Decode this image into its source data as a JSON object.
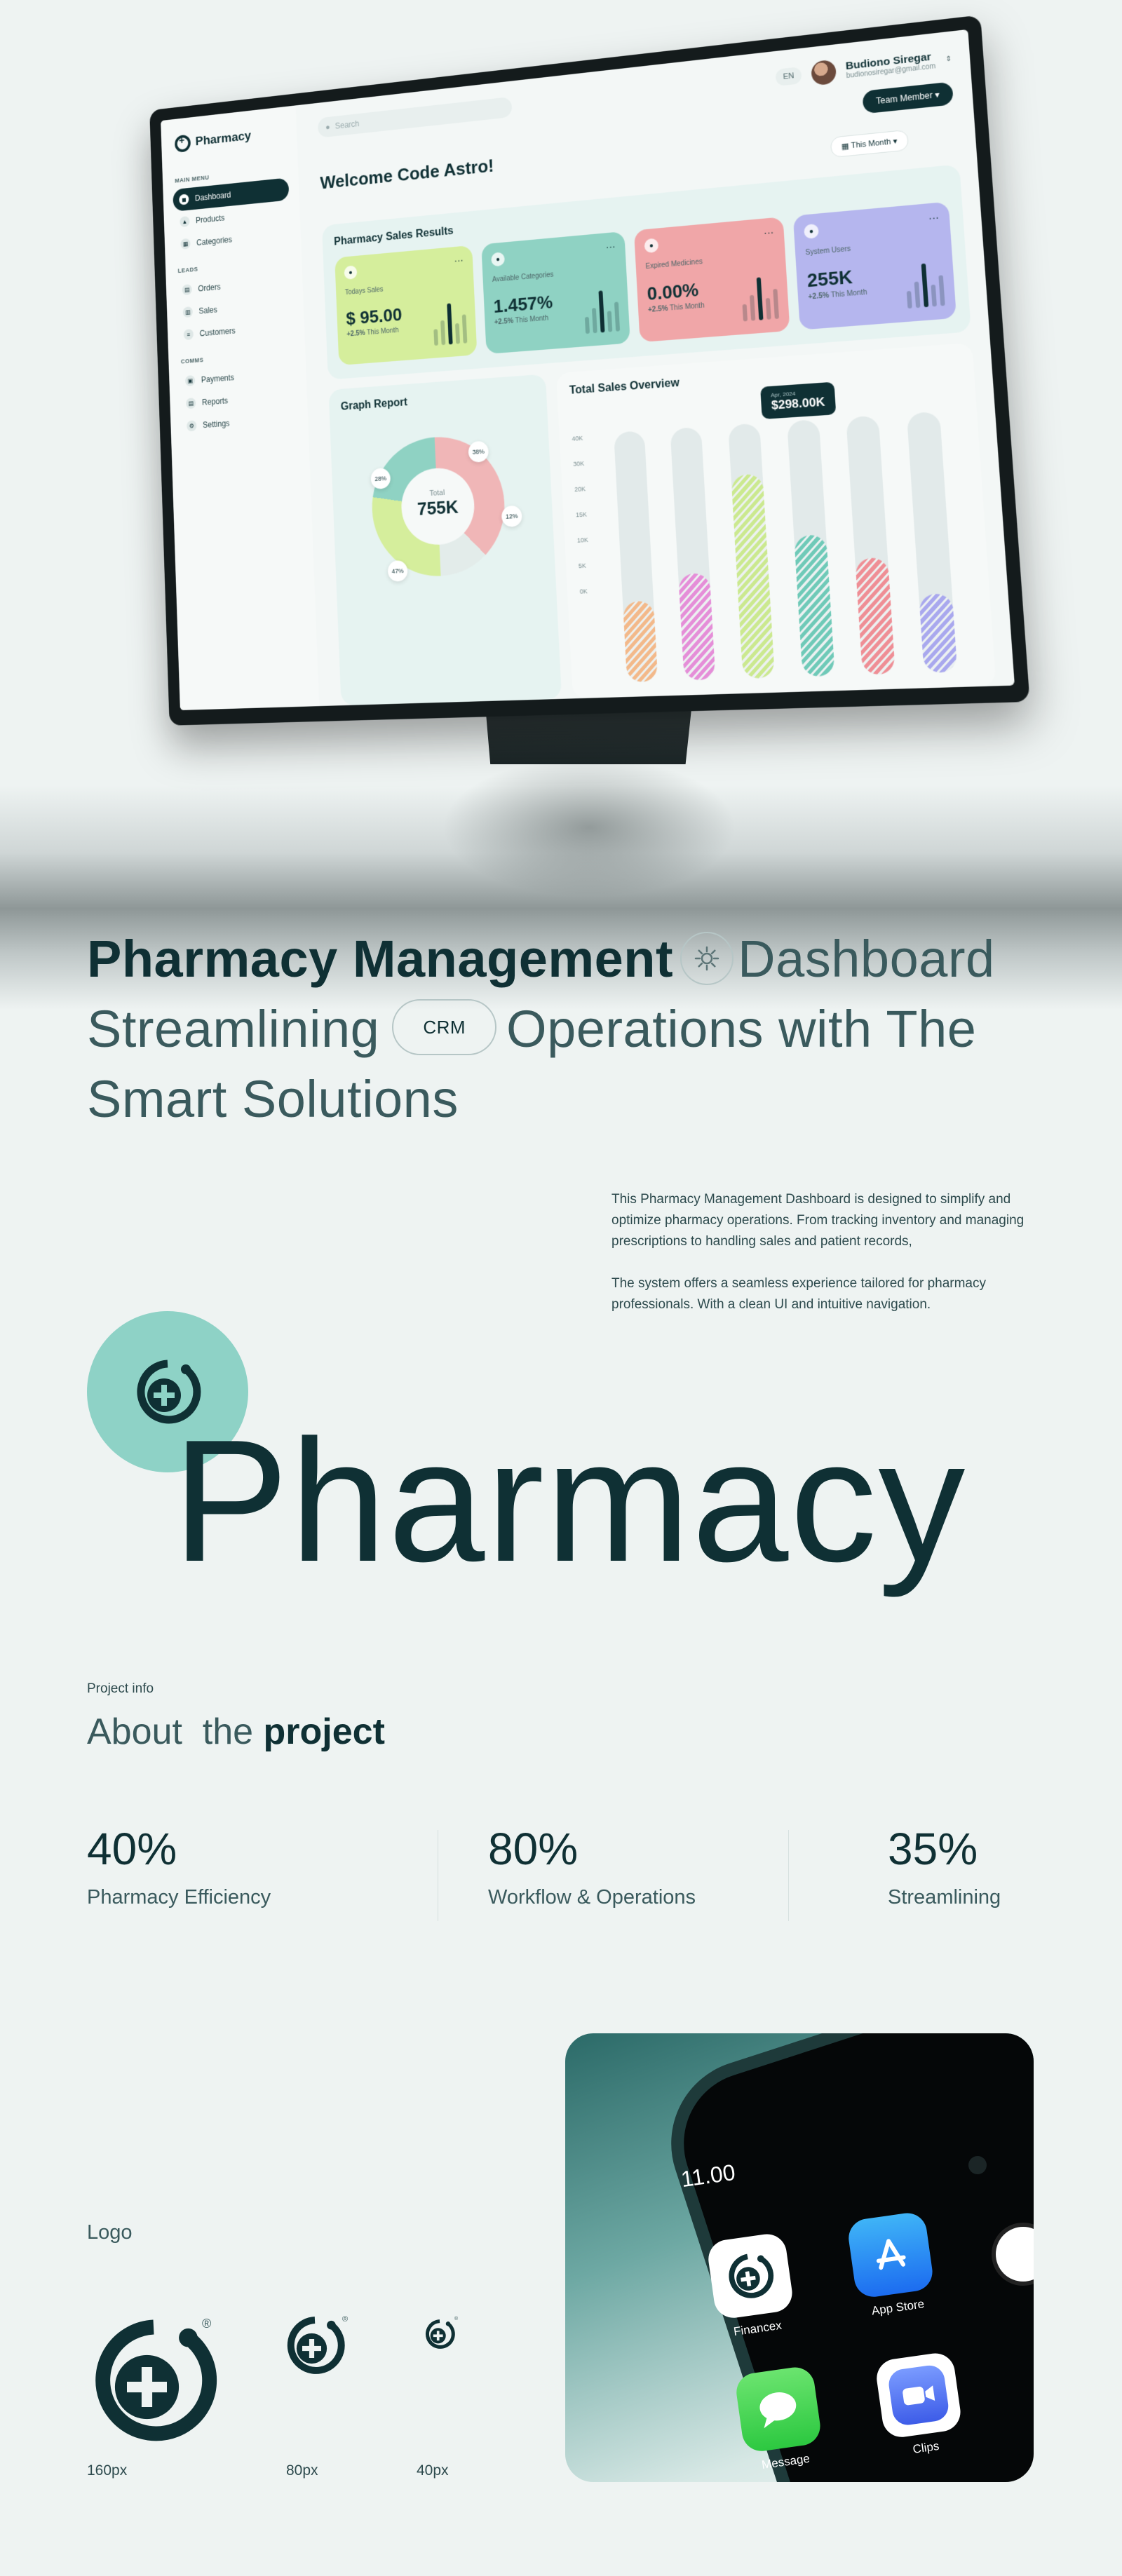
{
  "dashboard": {
    "brand": "Pharmacy",
    "search_placeholder": "Search",
    "lang": "EN",
    "user_name": "Budiono Siregar",
    "user_email": "budionosiregar@gmail.com",
    "team_button": "Team Member",
    "welcome": "Welcome Code Astro!",
    "period_button": "This Month",
    "menu_groups": [
      {
        "label": "MAIN MENU",
        "items": [
          "Dashboard",
          "Products",
          "Categories"
        ]
      },
      {
        "label": "LEADS",
        "items": [
          "Orders",
          "Sales",
          "Customers"
        ]
      },
      {
        "label": "COMMS",
        "items": [
          "Payments",
          "Reports",
          "Settings"
        ]
      }
    ],
    "sales_title": "Pharmacy Sales Results",
    "kpis": [
      {
        "label": "Todays Sales",
        "value": "$ 95.00",
        "change": "+2.5%",
        "period": "This Month",
        "color": "#d5ee9c"
      },
      {
        "label": "Available Categories",
        "value": "1.457%",
        "change": "+2.5%",
        "period": "This Month",
        "color": "#8fd2c3"
      },
      {
        "label": "Expired Medicines",
        "value": "0.00%",
        "change": "+2.5%",
        "period": "This Month",
        "color": "#f0a6a8"
      },
      {
        "label": "System Users",
        "value": "255K",
        "change": "+2.5%",
        "period": "This Month",
        "color": "#b5b6ee"
      }
    ],
    "graph_title": "Graph Report",
    "donut_total_label": "Total",
    "donut_total_value": "755K",
    "donut_pcts": [
      "28%",
      "38%",
      "12%",
      "47%"
    ],
    "overview_title": "Total Sales Overview",
    "overview_axis": [
      "40K",
      "30K",
      "20K",
      "15K",
      "10K",
      "5K",
      "0K"
    ],
    "overview_tip_date": "Apr, 2024",
    "overview_tip_value": "$298.00K",
    "overview_bars": [
      {
        "fill": 0.32,
        "color": "#f3b98a"
      },
      {
        "fill": 0.42,
        "color": "#e58ed8"
      },
      {
        "fill": 0.8,
        "color": "#cbe98f"
      },
      {
        "fill": 0.55,
        "color": "#6fcab8"
      },
      {
        "fill": 0.45,
        "color": "#ef8e95"
      },
      {
        "fill": 0.3,
        "color": "#a9a8ee"
      }
    ]
  },
  "headline": {
    "line1_strong": "Pharmacy Management",
    "line1_rest": "Dashboard",
    "line2_a": "Streamlining",
    "chip": "CRM",
    "line2_b": "Operations with The",
    "line3": "Smart Solutions"
  },
  "description": [
    "This Pharmacy Management Dashboard is designed to simplify and optimize pharmacy operations. From tracking inventory and managing prescriptions to handling sales and patient records,",
    "The system offers a seamless experience tailored for pharmacy professionals. With a clean UI and intuitive navigation."
  ],
  "big_word": "Pharmacy",
  "project": {
    "info_label": "Project info",
    "about_prefix": "About  the",
    "about_strong": "project"
  },
  "stats": [
    {
      "value": "40%",
      "label": "Pharmacy Efficiency"
    },
    {
      "value": "80%",
      "label": "Workflow & Operations"
    },
    {
      "value": "35%",
      "label": "Streamlining"
    }
  ],
  "logo": {
    "title": "Logo",
    "sizes": [
      "160px",
      "80px",
      "40px"
    ],
    "registered": "®"
  },
  "phone": {
    "time": "11.00",
    "apps": [
      "Financex",
      "App Store",
      "Message",
      "Clips"
    ]
  },
  "colors": {
    "primary": "#0f3034",
    "accent": "#8ed2c6",
    "background": "#eef3f2"
  }
}
